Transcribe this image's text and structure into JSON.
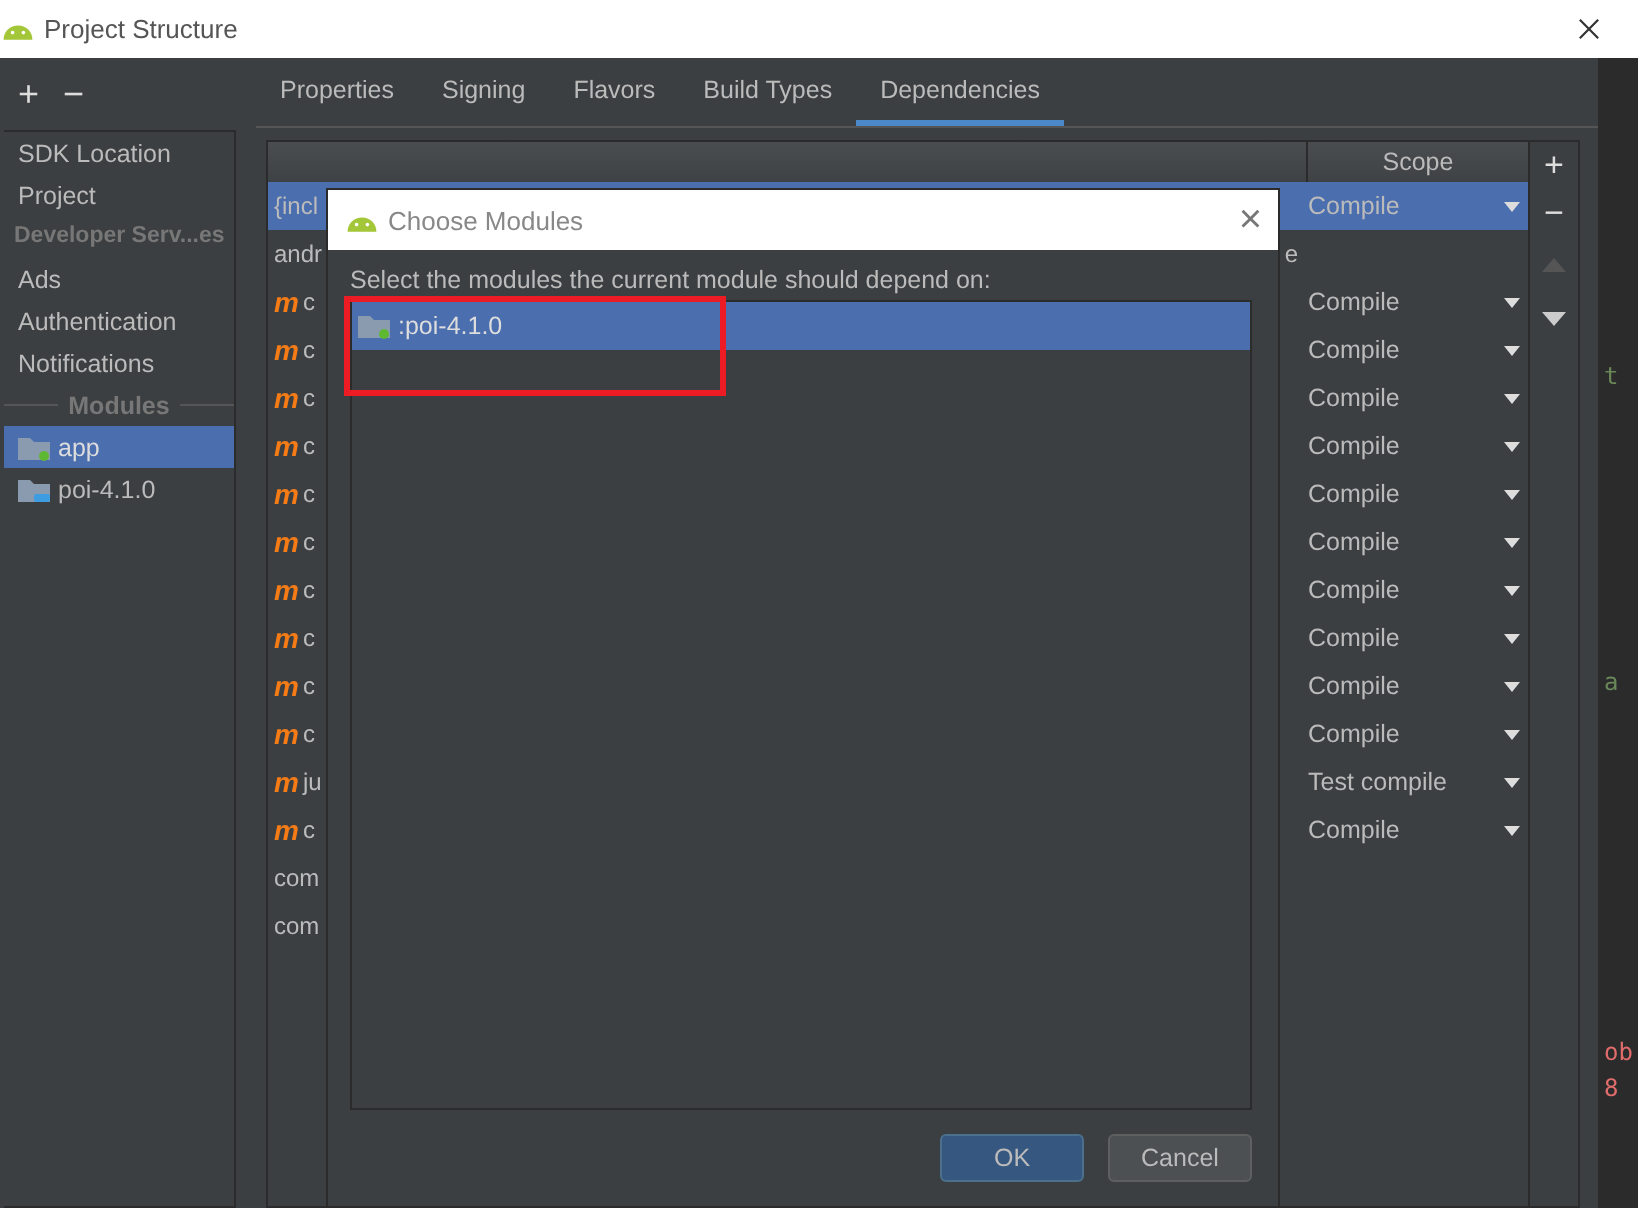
{
  "window": {
    "title": "Project Structure"
  },
  "sidebar": {
    "toolbar": [
      "+",
      "−"
    ],
    "sections": [
      {
        "items": [
          {
            "label": "SDK Location",
            "kind": "plain",
            "selected": false
          },
          {
            "label": "Project",
            "kind": "plain",
            "selected": false
          }
        ]
      },
      {
        "header": "Developer Serv...es",
        "items": [
          {
            "label": "Ads",
            "kind": "plain",
            "selected": false
          },
          {
            "label": "Authentication",
            "kind": "plain",
            "selected": false
          },
          {
            "label": "Notifications",
            "kind": "plain",
            "selected": false
          }
        ]
      },
      {
        "header": "Modules",
        "items": [
          {
            "label": "app",
            "kind": "app",
            "selected": true
          },
          {
            "label": "poi-4.1.0",
            "kind": "library",
            "selected": false
          }
        ]
      }
    ]
  },
  "tabs": [
    {
      "label": "Properties",
      "selected": false
    },
    {
      "label": "Signing",
      "selected": false
    },
    {
      "label": "Flavors",
      "selected": false
    },
    {
      "label": "Build Types",
      "selected": false
    },
    {
      "label": "Dependencies",
      "selected": true
    }
  ],
  "table": {
    "columns": [
      "Scope"
    ],
    "rows": [
      {
        "name": "{incl",
        "kind": "file",
        "scope": "Compile",
        "selected": true
      },
      {
        "name": "andr",
        "kind": "file",
        "tail": "e",
        "selected": false
      },
      {
        "icon": "m",
        "name": "c",
        "kind": "maven",
        "scope": "Compile",
        "selected": false
      },
      {
        "icon": "m",
        "name": "c",
        "kind": "maven",
        "scope": "Compile",
        "selected": false
      },
      {
        "icon": "m",
        "name": "c",
        "kind": "maven",
        "scope": "Compile",
        "selected": false
      },
      {
        "icon": "m",
        "name": "c",
        "kind": "maven",
        "scope": "Compile",
        "selected": false
      },
      {
        "icon": "m",
        "name": "c",
        "kind": "maven",
        "scope": "Compile",
        "selected": false
      },
      {
        "icon": "m",
        "name": "c",
        "kind": "maven",
        "scope": "Compile",
        "selected": false
      },
      {
        "icon": "m",
        "name": "c",
        "kind": "maven",
        "scope": "Compile",
        "selected": false
      },
      {
        "icon": "m",
        "name": "c",
        "kind": "maven",
        "scope": "Compile",
        "selected": false
      },
      {
        "icon": "m",
        "name": "c",
        "kind": "maven",
        "scope": "Compile",
        "selected": false
      },
      {
        "icon": "m",
        "name": "c",
        "kind": "maven",
        "scope": "Compile",
        "selected": false
      },
      {
        "icon": "m",
        "name": "ju",
        "kind": "maven",
        "scope": "Test compile",
        "selected": false
      },
      {
        "icon": "m",
        "name": "c",
        "kind": "maven",
        "scope": "Compile",
        "selected": false
      },
      {
        "name": "com",
        "kind": "file",
        "selected": false
      },
      {
        "name": "com",
        "kind": "file",
        "selected": false
      }
    ],
    "side_buttons": [
      "+",
      "−"
    ]
  },
  "editor_fragments": [
    {
      "text": "t",
      "kind": "code"
    },
    {
      "text": "a",
      "kind": "code"
    },
    {
      "text": "ob",
      "kind": "error"
    },
    {
      "text": "8",
      "kind": "error"
    }
  ],
  "dialog": {
    "title": "Choose Modules",
    "instruction": "Select the modules the current module should depend on:",
    "close": "×",
    "modules": [
      {
        "label": ":poi-4.1.0",
        "selected": true
      }
    ],
    "buttons": [
      {
        "label": "OK",
        "kind": "primary"
      },
      {
        "label": "Cancel",
        "kind": "secondary"
      }
    ]
  }
}
